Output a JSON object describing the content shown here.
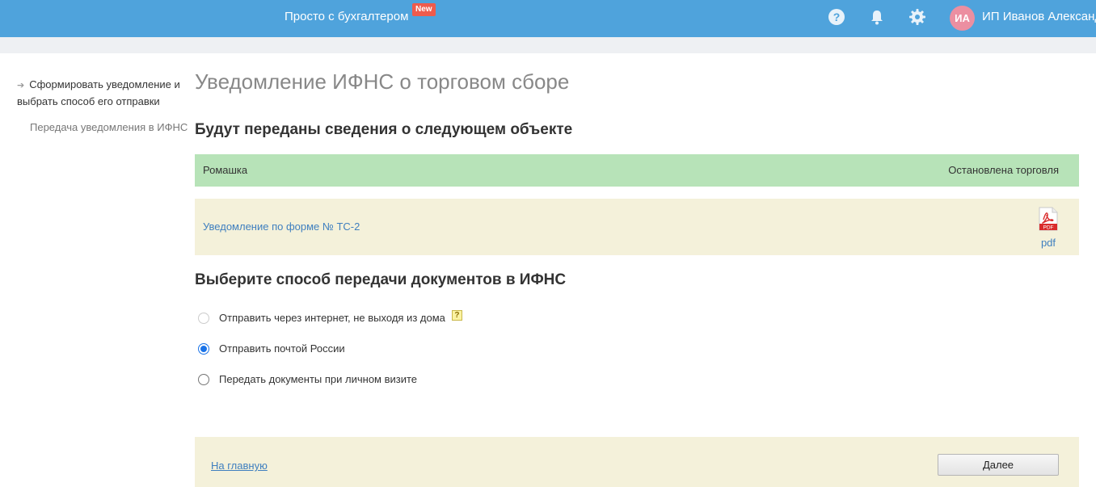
{
  "header": {
    "brand": "Просто с бухгалтером",
    "new_badge": "New",
    "avatar_initials": "ИА",
    "user_name": "ИП Иванов Александр",
    "icons": [
      "help-icon",
      "bell-icon",
      "gear-icon"
    ],
    "bar_color": "#4fa3dc"
  },
  "sidebar": {
    "steps": [
      {
        "label": "Сформировать уведомление и выбрать способ его отправки",
        "active": true
      },
      {
        "label": "Передача уведомления в ИФНС",
        "active": false
      }
    ]
  },
  "main": {
    "title": "Уведомление ИФНС о торговом сборе",
    "object_heading": "Будут переданы сведения о следующем объекте",
    "object": {
      "name": "Ромашка",
      "status": "Остановлена торговля"
    },
    "document": {
      "link": "Уведомление по форме № ТС-2",
      "format": "pdf",
      "icon": "pdf-icon",
      "icon_text": "PDF"
    },
    "method_heading": "Выберите способ передачи документов в ИФНС",
    "methods": [
      {
        "label": "Отправить через интернет, не выходя из дома",
        "selected": false,
        "disabled": true,
        "help": "?"
      },
      {
        "label": "Отправить почтой России",
        "selected": true,
        "disabled": false
      },
      {
        "label": "Передать документы при личном визите",
        "selected": false,
        "disabled": false
      }
    ]
  },
  "footer": {
    "home_link": "На главную",
    "next_button": "Далее"
  }
}
